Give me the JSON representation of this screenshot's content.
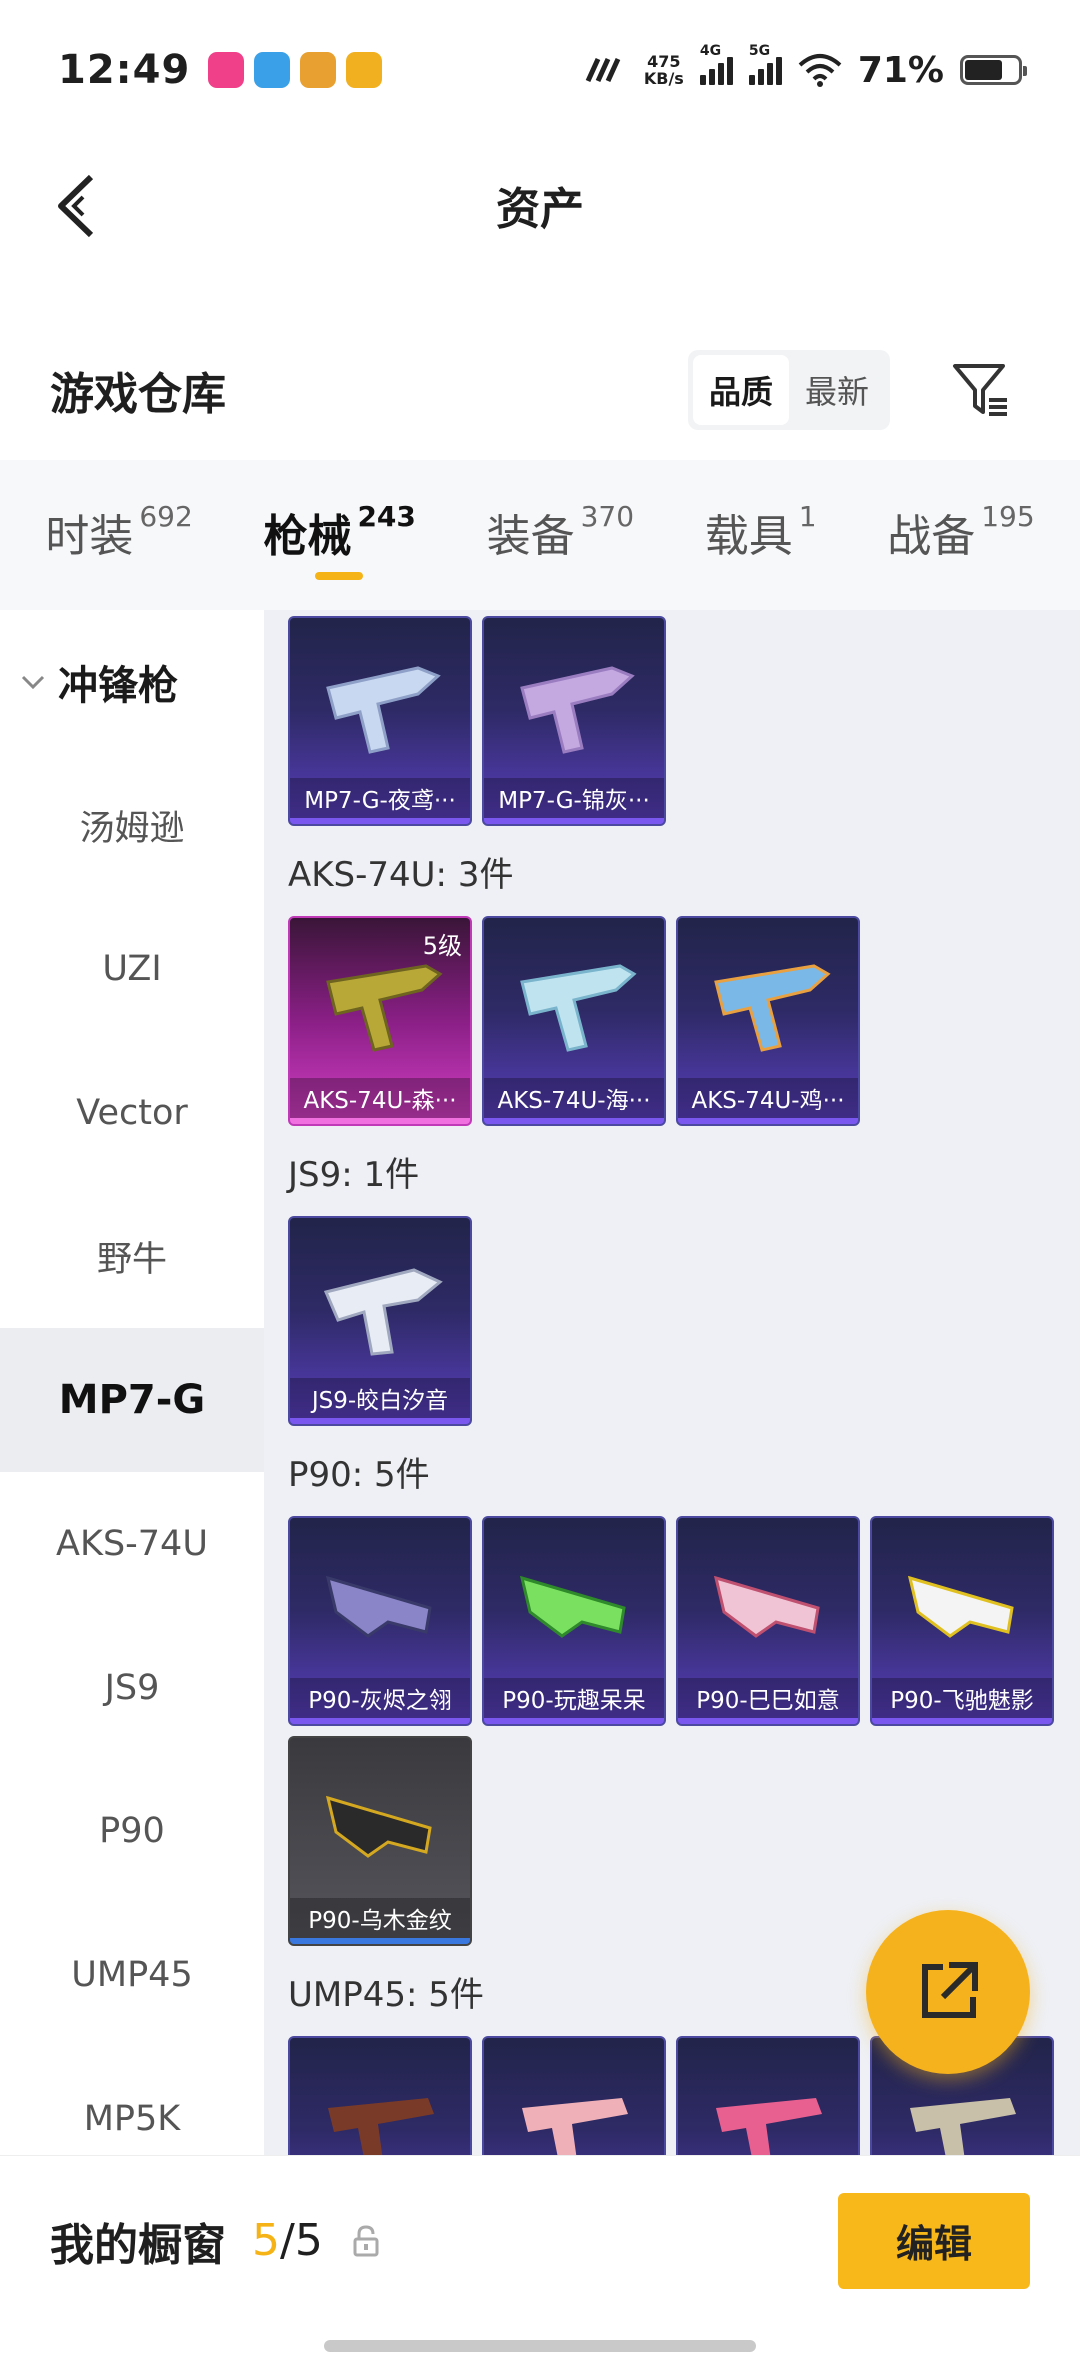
{
  "status_bar": {
    "time": "12:49",
    "net_speed_top": "475",
    "net_speed_bottom": "KB/s",
    "sim1": "4G",
    "sim2": "5G",
    "battery": "71%",
    "app_icon_colors": [
      "#f0408a",
      "#3aa0e8",
      "#e8a030",
      "#f0b020"
    ]
  },
  "nav": {
    "title": "资产"
  },
  "header": {
    "title": "游戏仓库",
    "sort_quality": "品质",
    "sort_latest": "最新"
  },
  "tabs": [
    {
      "label": "时装",
      "count": "692"
    },
    {
      "label": "枪械",
      "count": "243"
    },
    {
      "label": "装备",
      "count": "370"
    },
    {
      "label": "载具",
      "count": "1"
    },
    {
      "label": "战备",
      "count": "195"
    }
  ],
  "sidebar": {
    "group": "冲锋枪",
    "items": [
      "汤姆逊",
      "UZI",
      "Vector",
      "野牛",
      "MP7-G",
      "AKS-74U",
      "JS9",
      "P90",
      "UMP45",
      "MP5K"
    ]
  },
  "content": {
    "mp7": {
      "cards": [
        "MP7-G-夜鸢···",
        "MP7-G-锦灰···"
      ]
    },
    "aks": {
      "title": "AKS-74U: 3件",
      "level": "5级",
      "cards": [
        "AKS-74U-森···",
        "AKS-74U-海···",
        "AKS-74U-鸡···"
      ]
    },
    "js9": {
      "title": "JS9: 1件",
      "cards": [
        "JS9-皎白汐音"
      ]
    },
    "p90": {
      "title": "P90: 5件",
      "cards": [
        "P90-灰烬之翎",
        "P90-玩趣呆呆",
        "P90-巳巳如意",
        "P90-飞驰魅影",
        "P90-乌木金纹"
      ]
    },
    "ump": {
      "title": "UMP45: 5件"
    }
  },
  "bottom": {
    "label": "我的橱窗",
    "count_current": "5",
    "count_sep": "/",
    "count_total": "5",
    "edit": "编辑"
  },
  "colors": {
    "accent": "#f5b316",
    "card_purple": "#5a3fbf",
    "card_pink": "#d43fc5"
  }
}
